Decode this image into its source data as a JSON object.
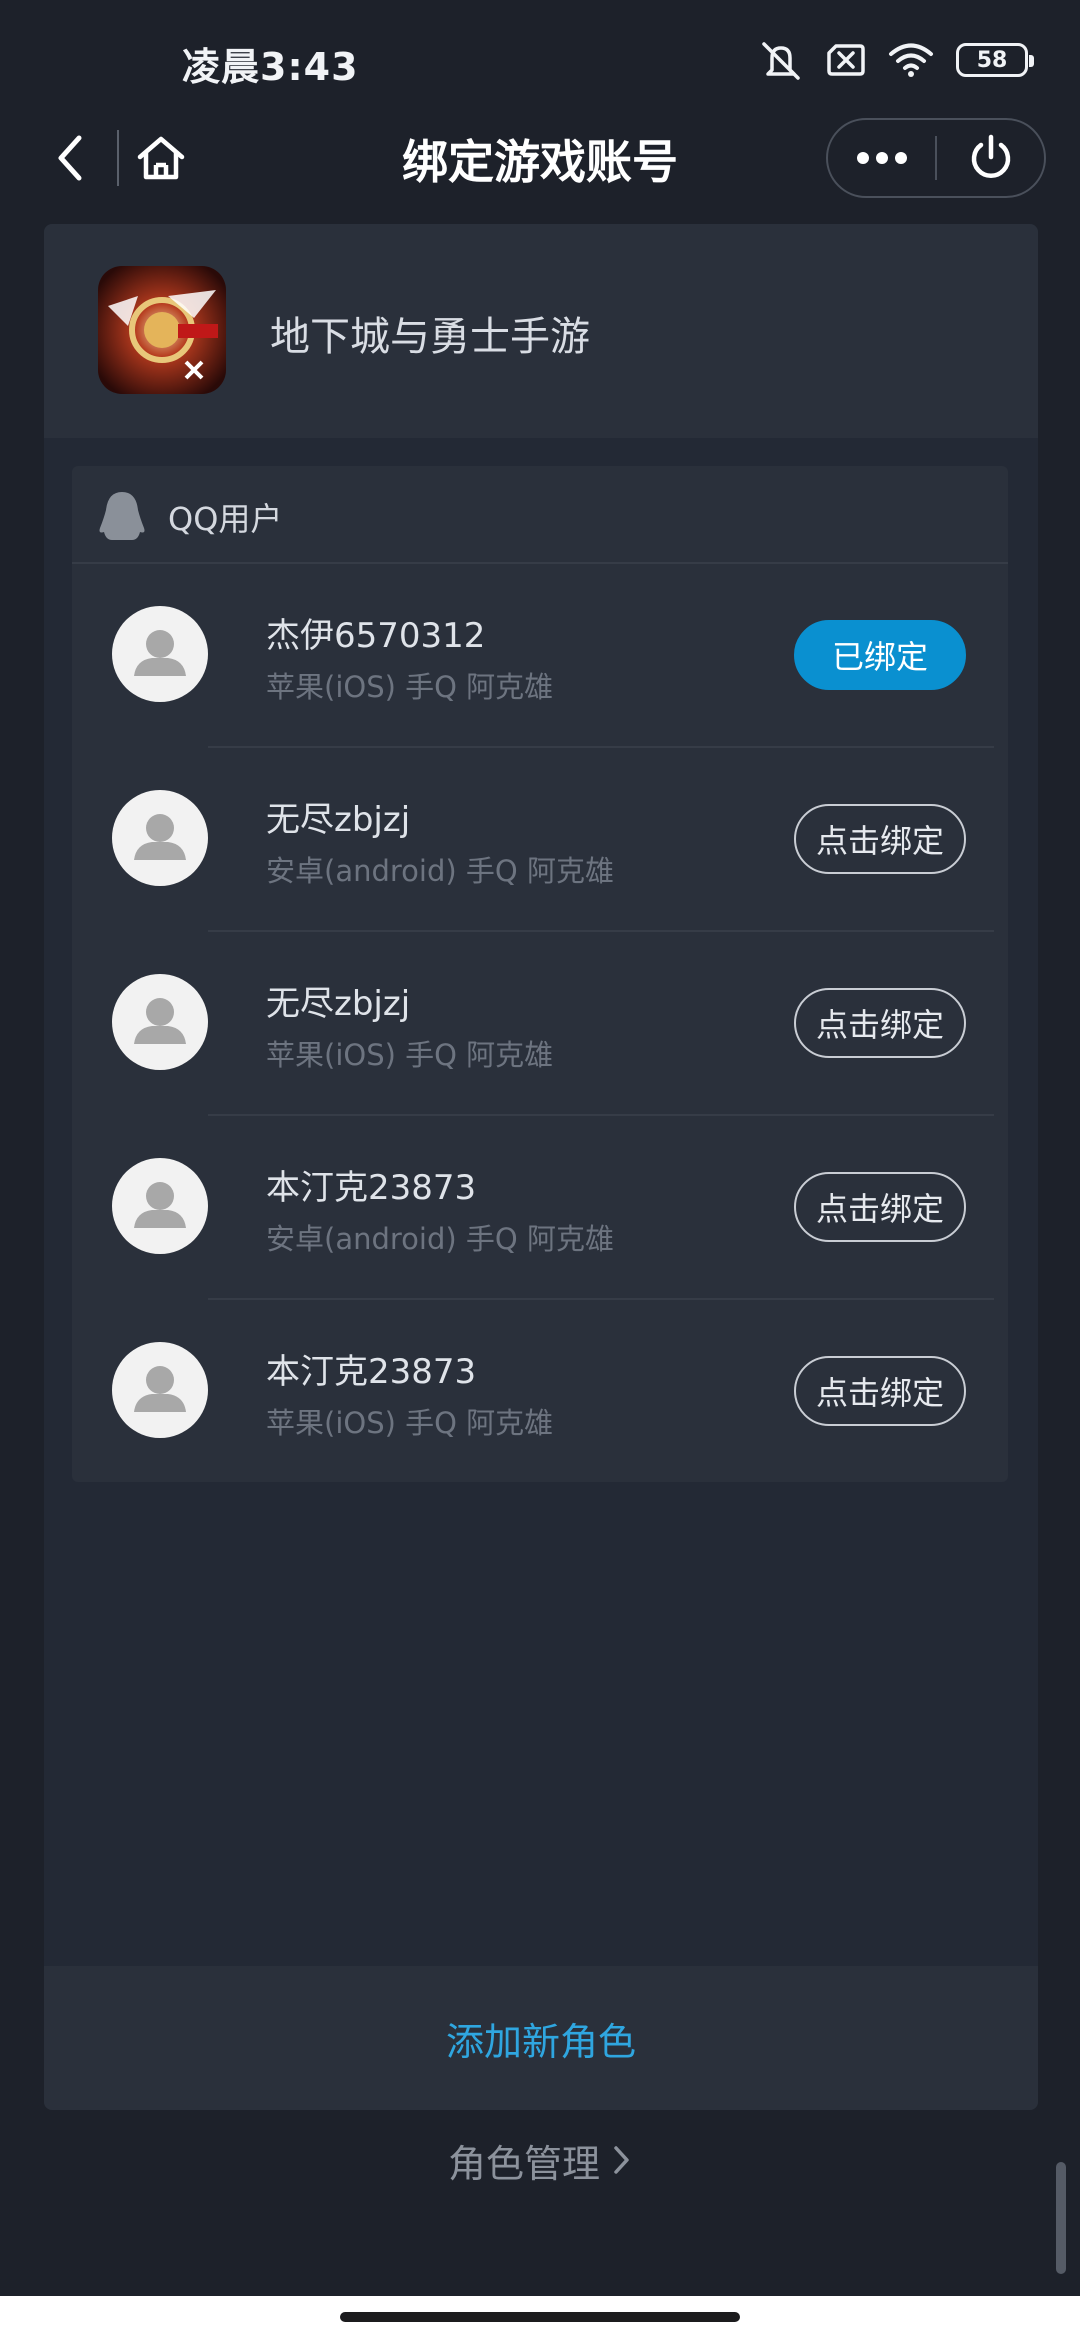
{
  "status_bar": {
    "time": "凌晨3:43",
    "battery": "58",
    "icons": [
      "mute-icon",
      "no-sim-icon",
      "wifi-icon",
      "battery-icon"
    ]
  },
  "nav": {
    "title": "绑定游戏账号",
    "back_icon": "chevron-left-icon",
    "home_icon": "home-icon",
    "more_icon": "more-dots-icon",
    "close_icon": "power-icon"
  },
  "game": {
    "name": "地下城与勇士手游",
    "icon": "dnf-game-icon"
  },
  "account_card": {
    "title": "QQ用户",
    "icon": "qq-penguin-icon",
    "accounts": [
      {
        "name": "杰伊6570312",
        "platform": "苹果(iOS) 手Q 阿克雄",
        "button": "已绑定",
        "bound": true
      },
      {
        "name": "无尽zbjzj",
        "platform": "安卓(android) 手Q 阿克雄",
        "button": "点击绑定",
        "bound": false
      },
      {
        "name": "无尽zbjzj",
        "platform": "苹果(iOS) 手Q 阿克雄",
        "button": "点击绑定",
        "bound": false
      },
      {
        "name": "本汀克23873",
        "platform": "安卓(android) 手Q 阿克雄",
        "button": "点击绑定",
        "bound": false
      },
      {
        "name": "本汀克23873",
        "platform": "苹果(iOS) 手Q 阿克雄",
        "button": "点击绑定",
        "bound": false
      }
    ]
  },
  "footer": {
    "add_role": "添加新角色",
    "manage_roles": "角色管理"
  },
  "colors": {
    "background": "#1d212a",
    "panel": "#232935",
    "card": "#2a303b",
    "accent": "#0a90d0",
    "link": "#2fa6e0"
  }
}
